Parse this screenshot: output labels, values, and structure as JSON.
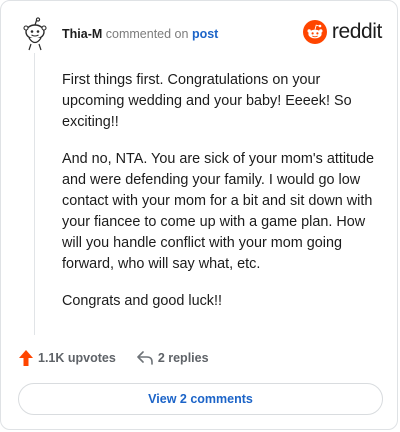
{
  "comment": {
    "author": "Thia-M",
    "action_text": "commented on",
    "target_link": "post",
    "paragraphs": [
      "First things first. Congratulations on your upcoming wedding and your baby! Eeeek! So exciting!!",
      "And no, NTA. You are sick of your mom's attitude and were defending your family. I would go low contact with your mom for a bit and sit down with your fiancee to come up with a game plan. How will you handle conflict with your mom going forward, who will say what, etc.",
      "Congrats and good luck!!"
    ]
  },
  "brand": {
    "wordmark": "reddit",
    "icon": "reddit-snoo-icon",
    "color": "#ff4500"
  },
  "actions": {
    "upvotes_label": "1.1K upvotes",
    "upvote_icon": "upvote-arrow-icon",
    "upvote_color": "#ff4500",
    "replies_label": "2 replies",
    "reply_icon": "reply-arrow-icon"
  },
  "view_comments_label": "View 2 comments",
  "avatar_icon": "snoo-avatar-icon"
}
